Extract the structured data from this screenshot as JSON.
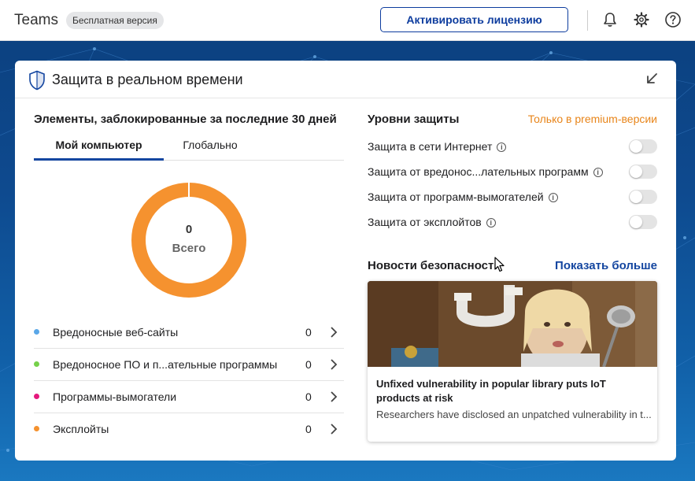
{
  "app": {
    "title": "Teams",
    "badge": "Бесплатная версия"
  },
  "header": {
    "activate_label": "Активировать лицензию"
  },
  "icons": {
    "notifications": "bell-icon",
    "settings": "gear-icon",
    "help": "help-icon"
  },
  "card": {
    "title": "Защита в реальном времени"
  },
  "blocked": {
    "title": "Элементы, заблокированные за последние 30 дней",
    "tabs": [
      {
        "label": "Мой компьютер"
      },
      {
        "label": "Глобально"
      }
    ],
    "total_value": "0",
    "total_label": "Всего",
    "categories": [
      {
        "label": "Вредоносные веб-сайты",
        "count": "0",
        "color": "#5aa7e8"
      },
      {
        "label": "Вредоносное ПО и п...ательные программы",
        "count": "0",
        "color": "#76d14a"
      },
      {
        "label": "Программы-вымогатели",
        "count": "0",
        "color": "#e5197d"
      },
      {
        "label": "Эксплойты",
        "count": "0",
        "color": "#f5922f"
      }
    ]
  },
  "protection": {
    "title": "Уровни защиты",
    "premium_label": "Только в premium-версии",
    "items": [
      {
        "label": "Защита в сети Интернет",
        "enabled": false
      },
      {
        "label": "Защита от вредонос...лательных программ",
        "enabled": false
      },
      {
        "label": "Защита от программ-вымогателей",
        "enabled": false
      },
      {
        "label": "Защита от эксплойтов",
        "enabled": false
      }
    ]
  },
  "news": {
    "title": "Новости безопасности",
    "show_more": "Показать больше",
    "headline": "Unfixed vulnerability in popular library puts IoT products at risk",
    "excerpt": "Researchers have disclosed an unpatched vulnerability in t..."
  },
  "colors": {
    "accent": "#1446a0",
    "premium": "#e8851a",
    "donut": "#f5922f"
  }
}
